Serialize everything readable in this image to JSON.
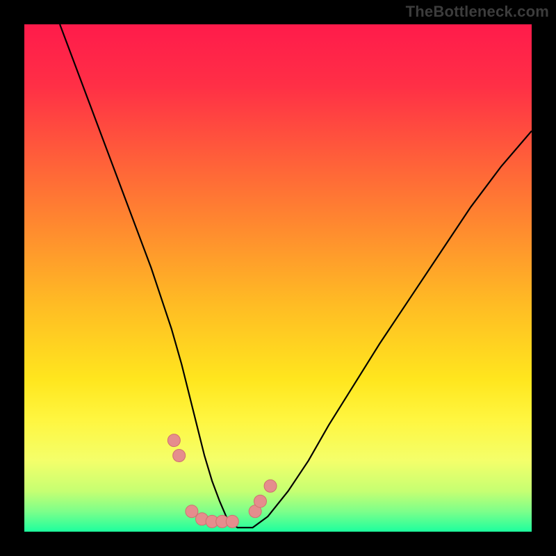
{
  "watermark": "TheBottleneck.com",
  "colors": {
    "curve_stroke": "#000000",
    "marker_fill": "#e58d8d",
    "marker_stroke": "#cf6f6f",
    "frame_bg": "#000000"
  },
  "gradient_stops": [
    {
      "offset": 0.0,
      "color": "#ff1b4b"
    },
    {
      "offset": 0.12,
      "color": "#ff2f46"
    },
    {
      "offset": 0.25,
      "color": "#ff5a3b"
    },
    {
      "offset": 0.4,
      "color": "#ff8a2f"
    },
    {
      "offset": 0.55,
      "color": "#ffbb24"
    },
    {
      "offset": 0.7,
      "color": "#ffe61e"
    },
    {
      "offset": 0.78,
      "color": "#fff640"
    },
    {
      "offset": 0.86,
      "color": "#f4ff6a"
    },
    {
      "offset": 0.92,
      "color": "#c6ff72"
    },
    {
      "offset": 0.96,
      "color": "#7dff8a"
    },
    {
      "offset": 1.0,
      "color": "#1dff9e"
    }
  ],
  "chart_data": {
    "type": "line",
    "title": "",
    "xlabel": "",
    "ylabel": "",
    "xlim": [
      0,
      100
    ],
    "ylim": [
      0,
      100
    ],
    "series": [
      {
        "name": "bottleneck-curve",
        "x": [
          7,
          10,
          13,
          16,
          19,
          22,
          25,
          27,
          29,
          31,
          32.5,
          34,
          35.5,
          37,
          38.5,
          40,
          42,
          45,
          48,
          52,
          56,
          60,
          65,
          70,
          76,
          82,
          88,
          94,
          100
        ],
        "y": [
          100,
          92,
          84,
          76,
          68,
          60,
          52,
          46,
          40,
          33,
          27,
          21,
          15,
          10,
          6,
          2.5,
          0.8,
          0.8,
          3,
          8,
          14,
          21,
          29,
          37,
          46,
          55,
          64,
          72,
          79
        ]
      }
    ],
    "markers": {
      "name": "highlighted-points",
      "x": [
        29.5,
        30.5,
        33,
        35,
        37,
        39,
        41,
        45.5,
        46.5,
        48.5
      ],
      "y": [
        18,
        15,
        4,
        2.5,
        2,
        2,
        2,
        4,
        6,
        9
      ]
    }
  }
}
